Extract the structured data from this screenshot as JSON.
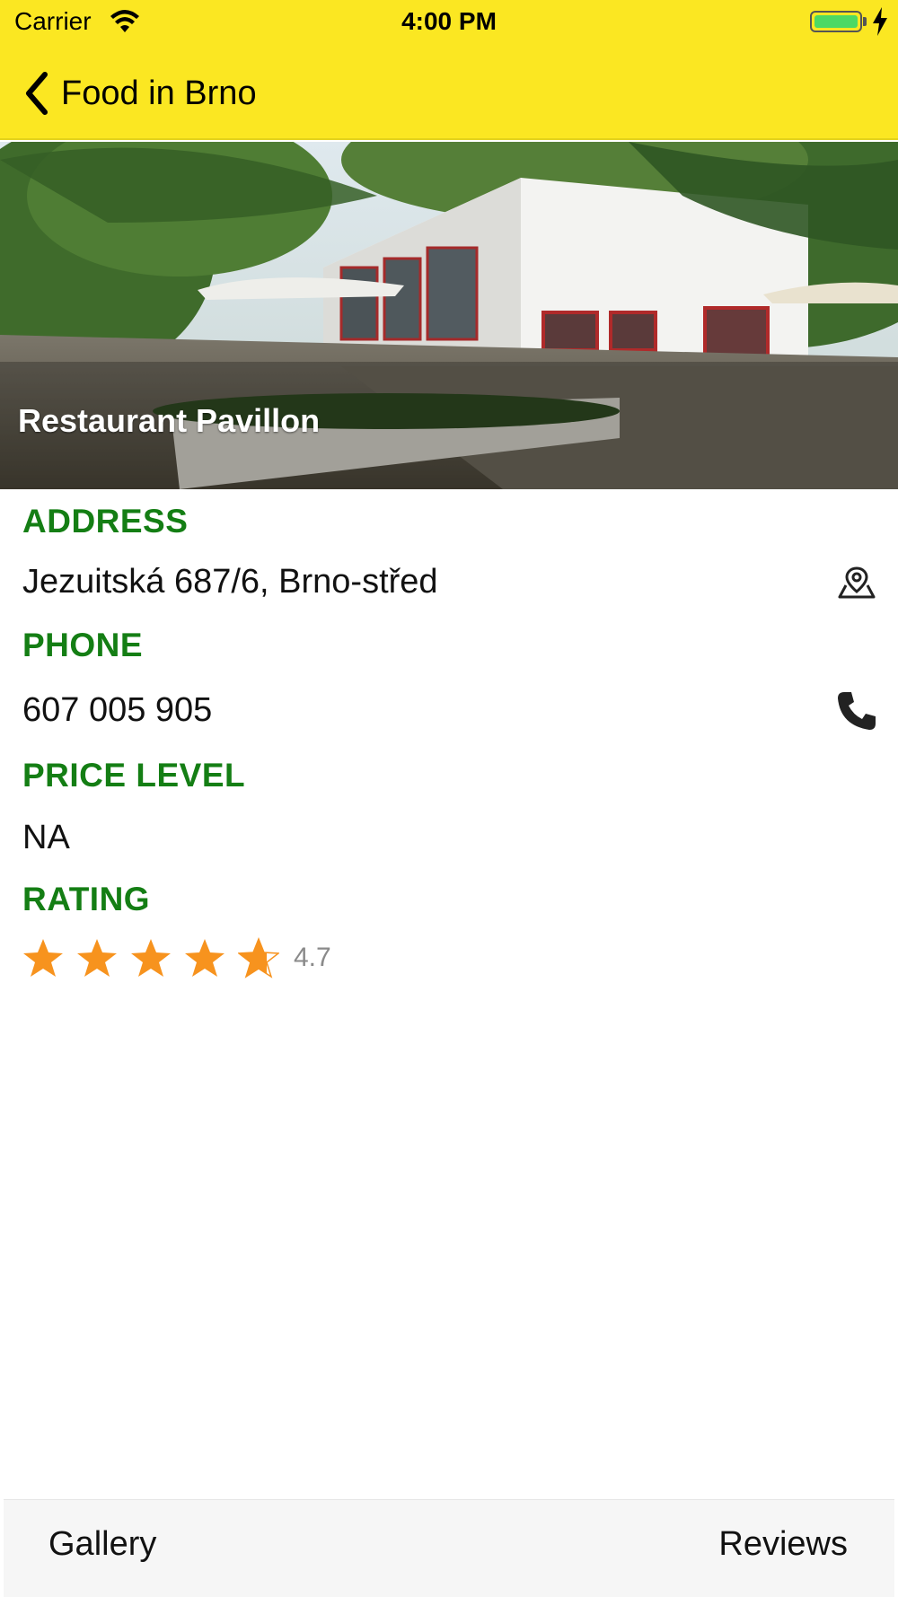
{
  "status_bar": {
    "carrier": "Carrier",
    "time": "4:00 PM",
    "icons": [
      "wifi-icon",
      "battery-icon",
      "charging-bolt-icon"
    ]
  },
  "nav": {
    "back_label": "Food in Brno",
    "back_icon": "chevron-left-icon",
    "bar_color": "#fbe722"
  },
  "restaurant": {
    "name": "Restaurant Pavillon"
  },
  "details": {
    "address_label": "ADDRESS",
    "address": "Jezuitská 687/6, Brno-střed",
    "address_icon": "map-pin-icon",
    "phone_label": "PHONE",
    "phone": "607 005 905",
    "phone_icon": "phone-icon",
    "price_label": "PRICE LEVEL",
    "price": "NA",
    "rating_label": "RATING",
    "rating": "4.7",
    "rating_max": 5,
    "label_color": "#147e14",
    "star_color": "#f7931e"
  },
  "tabs": {
    "gallery": "Gallery",
    "reviews": "Reviews"
  }
}
